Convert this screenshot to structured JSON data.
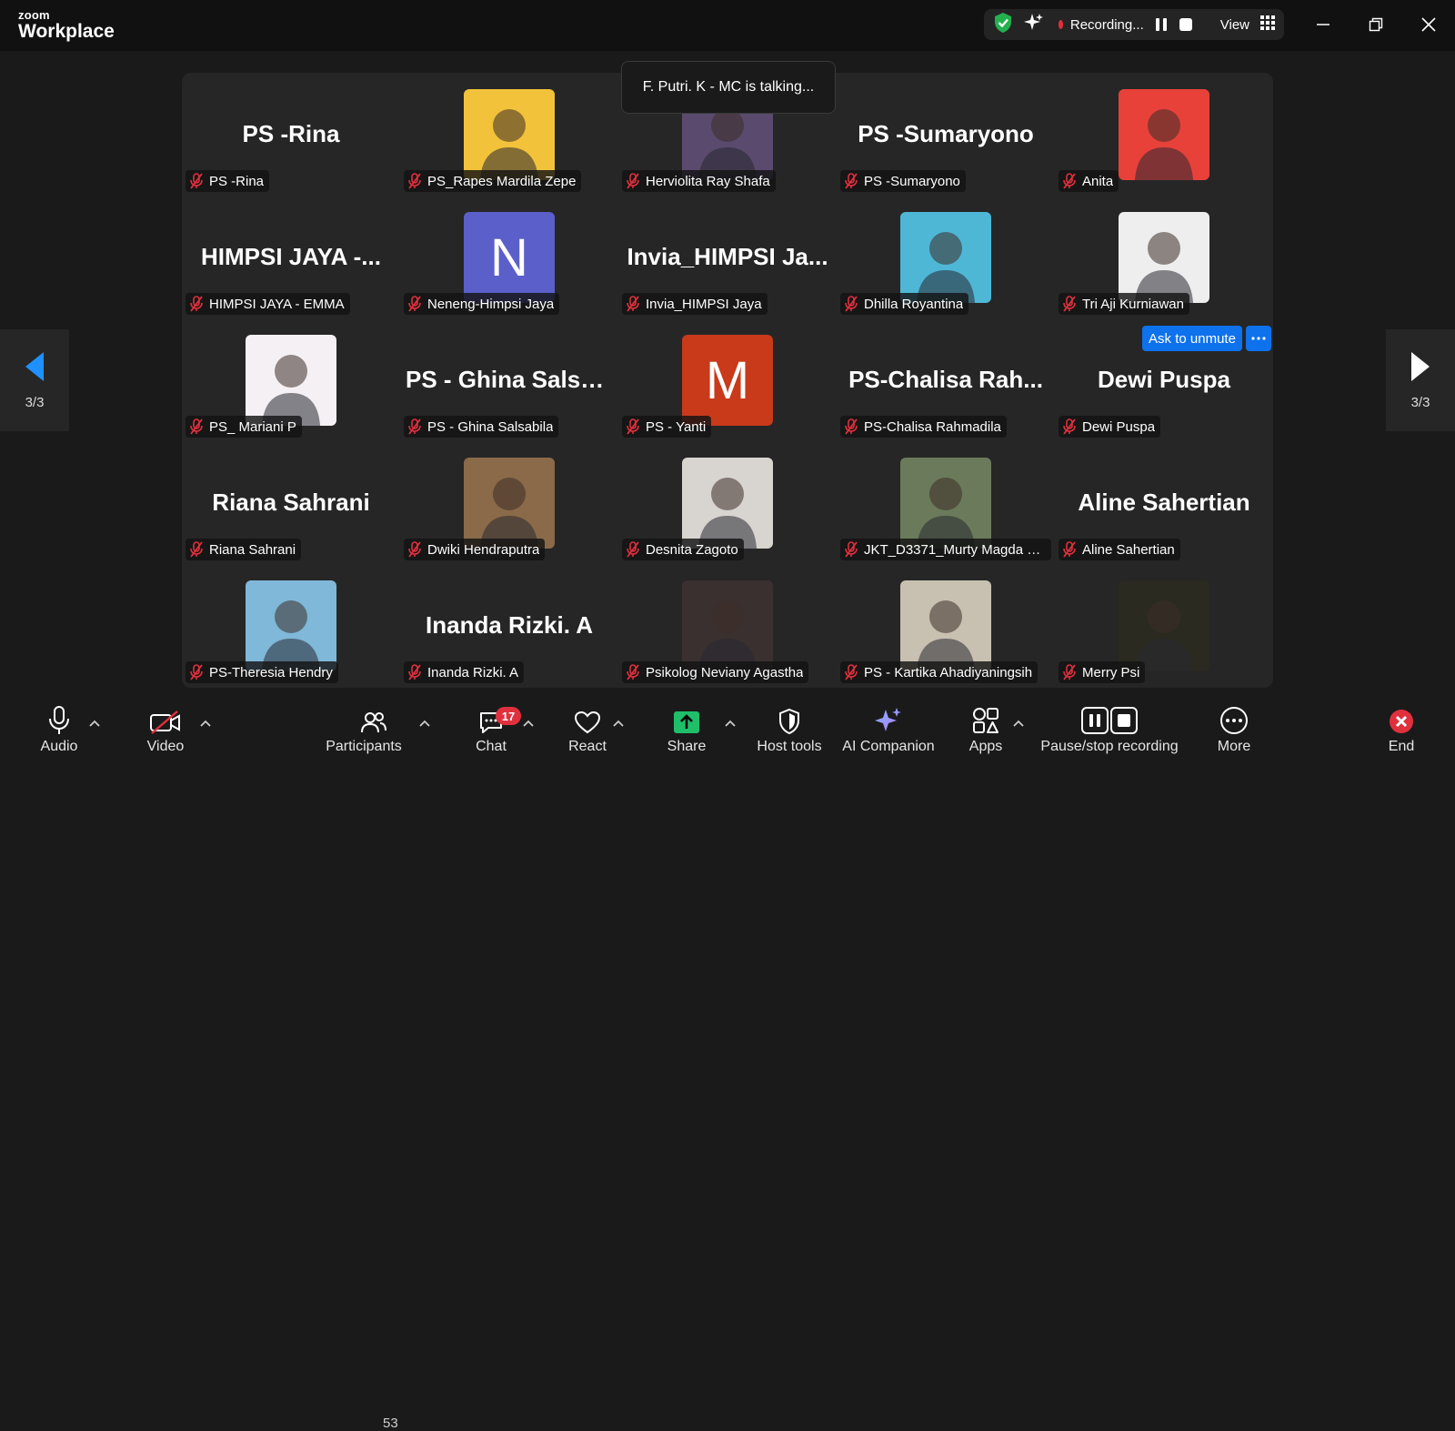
{
  "app": {
    "brand_top": "zoom",
    "brand_bottom": "Workplace"
  },
  "titlebar": {
    "recording_label": "Recording...",
    "view_label": "View"
  },
  "talking_indicator": "F. Putri. K - MC is talking...",
  "ask_unmute_label": "Ask to unmute",
  "pager": {
    "left_label": "3/3",
    "right_label": "3/3"
  },
  "tiles": [
    {
      "big": "PS -Rina",
      "label": "PS -Rina"
    },
    {
      "label": "PS_Rapes Mardila Zepe",
      "avatar_color": "#f2c23a"
    },
    {
      "label": "Herviolita Ray Shafa",
      "avatar_color": "#5a4a6e"
    },
    {
      "big": "PS -Sumaryono",
      "label": "PS -Sumaryono"
    },
    {
      "label": "Anita",
      "avatar_color": "#e8413a"
    },
    {
      "big": "HIMPSI JAYA -...",
      "label": "HIMPSI JAYA - EMMA"
    },
    {
      "label": "Neneng-Himpsi Jaya",
      "avatar_letter": "N",
      "avatar_color": "#5a5fc9"
    },
    {
      "big": "Invia_HIMPSI  Ja...",
      "label": "Invia_HIMPSI Jaya"
    },
    {
      "label": "Dhilla Royantina",
      "avatar_color": "#4fb7d6"
    },
    {
      "label": "Tri Aji Kurniawan",
      "avatar_color": "#eeeeee"
    },
    {
      "label": "PS_ Mariani P",
      "avatar_color": "#f4f0f4"
    },
    {
      "big": "PS  - Ghina Salsa...",
      "label": "PS - Ghina Salsabila"
    },
    {
      "label": "PS - Yanti",
      "avatar_letter": "M",
      "avatar_color": "#c83a1a"
    },
    {
      "big": "PS-Chalisa  Rah...",
      "label": "PS-Chalisa Rahmadila"
    },
    {
      "big": "Dewi Puspa",
      "label": "Dewi Puspa"
    },
    {
      "big": "Riana Sahrani",
      "label": "Riana Sahrani"
    },
    {
      "label": "Dwiki Hendraputra",
      "avatar_color": "#8a6a48"
    },
    {
      "label": "Desnita Zagoto",
      "avatar_color": "#d8d4d0"
    },
    {
      "label": "JKT_D3371_Murty Magda Pa...",
      "avatar_color": "#6a7a5a"
    },
    {
      "big": "Aline Sahertian",
      "label": "Aline Sahertian"
    },
    {
      "label": "PS-Theresia Hendry",
      "avatar_color": "#7fb8d8"
    },
    {
      "big": "Inanda Rizki. A",
      "label": "Inanda Rizki. A"
    },
    {
      "label": "Psikolog Neviany Agastha",
      "avatar_color": "#3a3030"
    },
    {
      "label": "PS - Kartika Ahadiyaningsih",
      "avatar_color": "#c8c0b0"
    },
    {
      "label": "Merry Psi",
      "avatar_color": "#2a2a20"
    }
  ],
  "toolbar": {
    "audio": "Audio",
    "video": "Video",
    "participants": "Participants",
    "participants_count": "53",
    "chat": "Chat",
    "chat_badge": "17",
    "react": "React",
    "share": "Share",
    "host_tools": "Host tools",
    "ai_companion": "AI Companion",
    "apps": "Apps",
    "pause_stop_recording": "Pause/stop recording",
    "more": "More",
    "end": "End"
  },
  "colors": {
    "accent_blue": "#0e72ed",
    "end_red": "#e0303d",
    "share_green": "#1fbf6a",
    "shield_green": "#22b14c"
  }
}
